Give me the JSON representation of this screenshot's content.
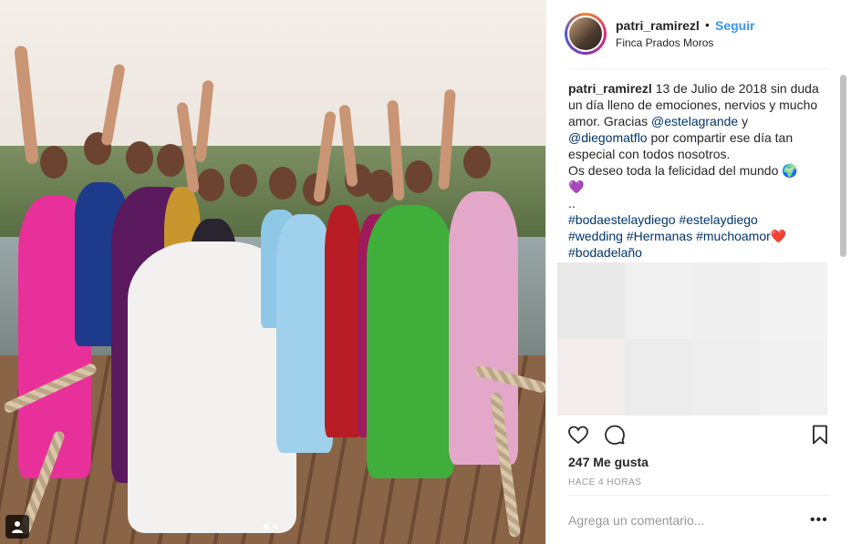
{
  "header": {
    "username": "patri_ramirezl",
    "separator": "•",
    "follow_label": "Seguir",
    "location": "Finca Prados Moros"
  },
  "caption": {
    "username": "patri_ramirezl",
    "text_1": " 13 de Julio de 2018 sin duda un día lleno de emociones, nervios y mucho amor. Gracias ",
    "mention_1": "@estelagrande",
    "text_2": " y ",
    "mention_2": "@diegomatflo",
    "text_3": " por compartir ese día tan especial con todos nosotros.",
    "line_2": "Os deseo toda la felicidad del mundo 🌍",
    "emoji_heart_purple": "💜",
    "line_dots": "..",
    "tags_line_1_a": "#bodaestelaydiego",
    "tags_line_1_b": "#estelaydiego",
    "tags_line_2_a": "#wedding",
    "tags_line_2_b": "#Hermanas",
    "tags_line_2_c": "#muchoamor",
    "emoji_heart_red": "❤️",
    "tags_line_3": "#bodadelaño"
  },
  "mosaic_colors": [
    "#e9e9e9",
    "#f0f0f0",
    "#efefef",
    "#f2f2f2",
    "#f3eded",
    "#ececec",
    "#eeeeee",
    "#f1f1f1"
  ],
  "actions": {
    "like_icon": "heart-icon",
    "comment_icon": "comment-icon",
    "save_icon": "bookmark-icon"
  },
  "likes": "247 Me gusta",
  "time_ago": "HACE 4 HORAS",
  "comment_placeholder": "Agrega un comentario...",
  "more_options": "•••",
  "photo": {
    "carousel_dots": 2,
    "active_dot": 0,
    "tag_icon": "user-tag-icon"
  },
  "colors": {
    "link": "#003569",
    "follow": "#3897f0",
    "muted": "#999999"
  }
}
